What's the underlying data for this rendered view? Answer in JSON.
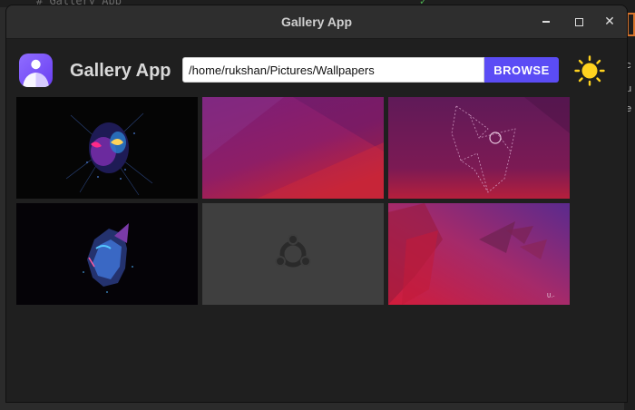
{
  "window": {
    "title": "Gallery App",
    "controls": [
      "minimize",
      "maximize",
      "close"
    ]
  },
  "background": {
    "editor_fragment": "# Gallery App"
  },
  "header": {
    "app_name": "Gallery App",
    "logo_icon": "gallery-app-logo-icon",
    "path_value": "/home/rukshan/Pictures/Wallpapers",
    "browse_label": "BROWSE",
    "theme_icon": "sun-icon"
  },
  "colors": {
    "accent": "#5b4cf5",
    "sun": "#ffd21f",
    "window_bg": "#1f1f1f"
  },
  "thumbnails": [
    {
      "name": "thumbnail-spiderman-neon-face",
      "theme": "dark-neon"
    },
    {
      "name": "thumbnail-purple-gradient",
      "theme": "purple-red"
    },
    {
      "name": "thumbnail-geometric-line-animal",
      "theme": "purple-red"
    },
    {
      "name": "thumbnail-blue-neon-face",
      "theme": "dark-blue"
    },
    {
      "name": "thumbnail-ubuntu-logo-gray",
      "theme": "gray"
    },
    {
      "name": "thumbnail-ubuntu-red-geometric",
      "theme": "red-purple"
    }
  ]
}
